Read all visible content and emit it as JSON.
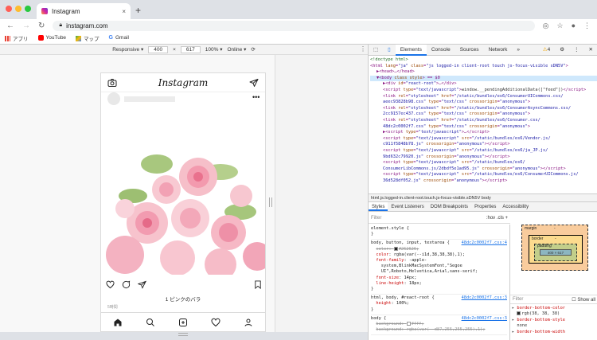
{
  "browser": {
    "tab_title": "Instagram",
    "tab_close": "×",
    "new_tab": "+",
    "url": "instagram.com",
    "bookmarks": [
      "アプリ",
      "YouTube",
      "マップ",
      "Gmail"
    ]
  },
  "device_toolbar": {
    "device": "Responsive",
    "width": "400",
    "x": "×",
    "height": "617",
    "zoom": "100%",
    "throttle": "Online"
  },
  "instagram": {
    "logo": "Instagram",
    "likes": "1 ピンクのバラ",
    "date": "5時間"
  },
  "devtools": {
    "tabs": [
      "Elements",
      "Console",
      "Sources",
      "Network",
      "»"
    ],
    "warnings": "4",
    "elements_lines": [
      {
        "indent": 0,
        "html": "<span class='c'>&lt;!doctype html&gt;</span>"
      },
      {
        "indent": 0,
        "html": "&lt;html <span class='a'>lang</span>=<span class='v'>\"ja\"</span> <span class='a'>class</span>=<span class='v'>\"js logged-in client-root touch js-focus-visible sDN5V\"</span>&gt;"
      },
      {
        "indent": 1,
        "html": "▶&lt;head&gt;…&lt;/head&gt;"
      },
      {
        "indent": 1,
        "html": "▼&lt;body <span class='a'>class</span> <span class='a'>style</span>&gt; == $0",
        "sel": true
      },
      {
        "indent": 2,
        "html": "▶&lt;div <span class='a'>id</span>=<span class='v'>\"react-root\"</span>&gt;…&lt;/div&gt;"
      },
      {
        "indent": 2,
        "html": "&lt;script <span class='a'>type</span>=<span class='v'>\"text/javascript\"</span>&gt;<span class='t'>window.__pendingAdditionalData([\"feed\"])</span>&lt;/script&gt;"
      },
      {
        "indent": 2,
        "html": "&lt;link <span class='a'>rel</span>=<span class='v'>\"stylesheet\"</span> <span class='a'>href</span>=<span class='v'>\"/static/bundles/es6/ConsumerUICommons.css/</span>"
      },
      {
        "indent": 2,
        "html": "<span class='v'>aeec93828b98.css\"</span> <span class='a'>type</span>=<span class='v'>\"text/css\"</span> <span class='a'>crossorigin</span>=<span class='v'>\"anonymous\"</span>&gt;"
      },
      {
        "indent": 2,
        "html": "&lt;link <span class='a'>rel</span>=<span class='v'>\"stylesheet\"</span> <span class='a'>href</span>=<span class='v'>\"/static/bundles/es6/ConsumerAsyncCommons.css/</span>"
      },
      {
        "indent": 2,
        "html": "<span class='v'>2cc9157ec437.css\"</span> <span class='a'>type</span>=<span class='v'>\"text/css\"</span> <span class='a'>crossorigin</span>=<span class='v'>\"anonymous\"</span>&gt;"
      },
      {
        "indent": 2,
        "html": "&lt;link <span class='a'>rel</span>=<span class='v'>\"stylesheet\"</span> <span class='a'>href</span>=<span class='v'>\"/static/bundles/es6/Consumer.css/</span>"
      },
      {
        "indent": 2,
        "html": "<span class='v'>48dc2c0002f7.css\"</span> <span class='a'>type</span>=<span class='v'>\"text/css\"</span> <span class='a'>crossorigin</span>=<span class='v'>\"anonymous\"</span>&gt;"
      },
      {
        "indent": 2,
        "html": "▶&lt;script <span class='a'>type</span>=<span class='v'>\"text/javascript\"</span>&gt;…&lt;/script&gt;"
      },
      {
        "indent": 2,
        "html": "&lt;script <span class='a'>type</span>=<span class='v'>\"text/javascript\"</span> <span class='a'>src</span>=<span class='v'>\"/static/bundles/es6/Vendor.js/</span>"
      },
      {
        "indent": 2,
        "html": "<span class='v'>c911f5848b78.js\"</span> <span class='a'>crossorigin</span>=<span class='v'>\"anonymous\"</span>&gt;&lt;/script&gt;"
      },
      {
        "indent": 2,
        "html": "&lt;script <span class='a'>type</span>=<span class='v'>\"text/javascript\"</span> <span class='a'>src</span>=<span class='v'>\"/static/bundles/es6/ja_JP.js/</span>"
      },
      {
        "indent": 2,
        "html": "<span class='v'>9bd632c79920.js\"</span> <span class='a'>crossorigin</span>=<span class='v'>\"anonymous\"</span>&gt;&lt;/script&gt;"
      },
      {
        "indent": 2,
        "html": "&lt;script <span class='a'>type</span>=<span class='v'>\"text/javascript\"</span> <span class='a'>src</span>=<span class='v'>\"/static/bundles/es6/</span>"
      },
      {
        "indent": 2,
        "html": "<span class='v'>ConsumerLibCommons.js/2dbdf5e1ad95.js\"</span> <span class='a'>crossorigin</span>=<span class='v'>\"anonymous\"</span>&gt;&lt;/script&gt;"
      },
      {
        "indent": 2,
        "html": "&lt;script <span class='a'>type</span>=<span class='v'>\"text/javascript\"</span> <span class='a'>src</span>=<span class='v'>\"/static/bundles/es6/ConsumerUICommons.js/</span>"
      },
      {
        "indent": 2,
        "html": "<span class='v'>36d528df052.js\"</span> <span class='a'>crossorigin</span>=<span class='v'>\"anonymous\"</span>&gt;&lt;/script&gt;"
      }
    ],
    "breadcrumb": "html.js.logged-in.client-root.touch.js-focus-visible.sDN5V   body",
    "style_tabs": [
      "Styles",
      "Event Listeners",
      "DOM Breakpoints",
      "Properties",
      "Accessibility"
    ],
    "filter_placeholder": "Filter",
    "filter_opts": ":hov  .cls  +",
    "box_model": {
      "margin": "margin",
      "border": "border",
      "padding": "padding",
      "content": "400 × 617",
      "dash": "-"
    },
    "computed_filter": "Filter",
    "show_all": "Show all",
    "computed": [
      {
        "prop": "border-bottom-color",
        "val": "rgb(38, 38, 38)",
        "swatch": "#262626"
      },
      {
        "prop": "border-bottom-style",
        "val": "none"
      },
      {
        "prop": "border-bottom-width",
        "val": ""
      }
    ]
  },
  "colors": {
    "accent": "#1a73e8",
    "ig_text": "#262626"
  }
}
